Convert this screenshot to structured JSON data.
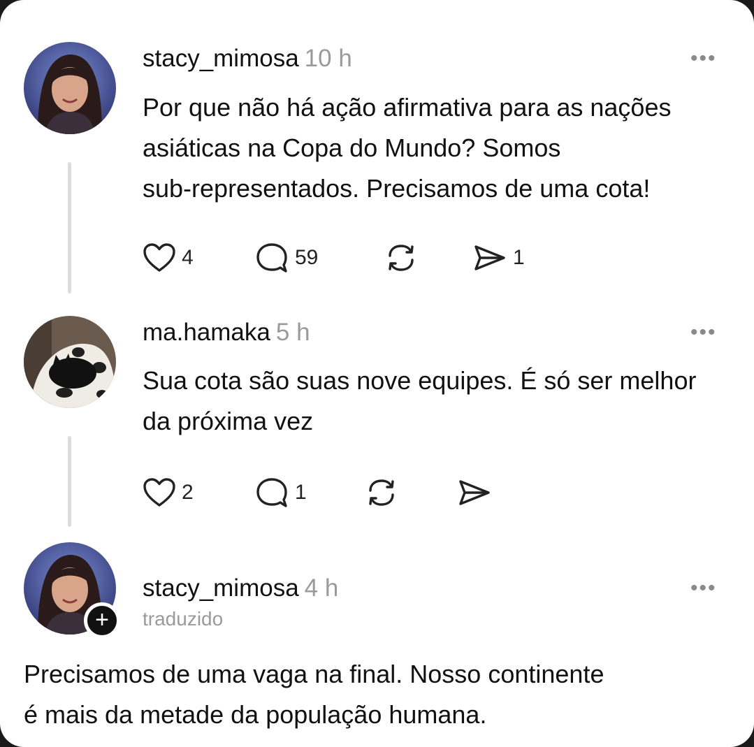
{
  "posts": [
    {
      "username": "stacy_mimosa",
      "time": "10 h",
      "text_lines": [
        "Por que não há ação afirmativa para as nações",
        "asiáticas na Copa do Mundo? Somos",
        "sub-representados. Precisamos de uma cota!"
      ],
      "likes": "4",
      "replies": "59",
      "shares": "1",
      "avatar_icon": "avatar-woman"
    },
    {
      "username": "ma.hamaka",
      "time": "5 h",
      "text_lines": [
        "Sua cota são suas nove equipes. É só ser melhor",
        "da próxima vez"
      ],
      "likes": "2",
      "replies": "1",
      "avatar_icon": "avatar-cat"
    },
    {
      "username": "stacy_mimosa",
      "time": "4 h",
      "subtitle": "traduzido",
      "text_lines": [
        "Precisamos de uma vaga na final. Nosso continente",
        "é mais da metade da população humana."
      ],
      "follow_symbol": "+",
      "avatar_icon": "avatar-woman"
    }
  ],
  "more_symbol": "•••",
  "colors": {
    "background": "#ffffff",
    "text": "#111111",
    "muted": "#9a9a9a",
    "thread_line": "#dcdcdc"
  }
}
